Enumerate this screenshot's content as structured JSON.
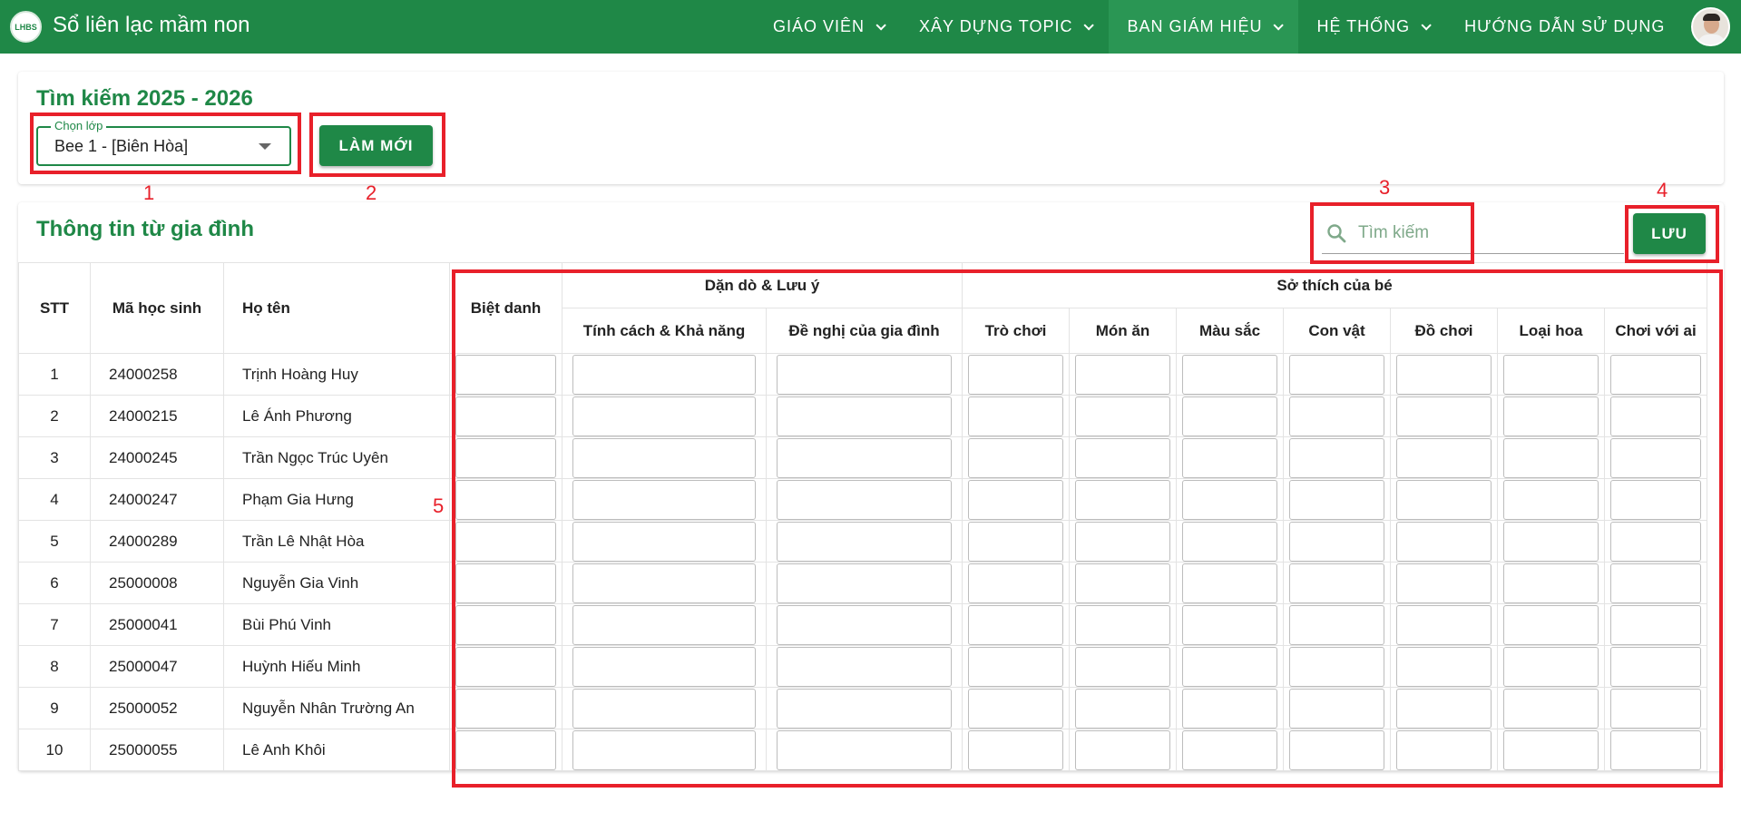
{
  "app": {
    "title": "Sổ liên lạc mầm non",
    "logo_text": "LHBS"
  },
  "nav": [
    {
      "label": "GIÁO VIÊN",
      "has_dropdown": true,
      "active": false
    },
    {
      "label": "XÂY DỰNG TOPIC",
      "has_dropdown": true,
      "active": false
    },
    {
      "label": "BAN GIÁM HIỆU",
      "has_dropdown": true,
      "active": true
    },
    {
      "label": "HỆ THỐNG",
      "has_dropdown": true,
      "active": false
    },
    {
      "label": "HƯỚNG DẪN SỬ DỤNG",
      "has_dropdown": false,
      "active": false
    }
  ],
  "search_card": {
    "title": "Tìm kiếm 2025 - 2026",
    "class_select": {
      "label": "Chọn lớp",
      "value": "Bee 1 - [Biên Hòa]"
    },
    "refresh_label": "LÀM MỚI"
  },
  "family_card": {
    "title": "Thông tin từ gia đình",
    "search_placeholder": "Tìm kiếm",
    "save_label": "LƯU"
  },
  "table": {
    "headers": {
      "stt": "STT",
      "student_code": "Mã học sinh",
      "full_name": "Họ tên",
      "nickname": "Biệt danh",
      "group_notes": "Dặn dò & Lưu ý",
      "personality": "Tính cách & Khả năng",
      "family_suggestion": "Đề nghị của gia đình",
      "group_hobbies": "Sở thích của bé",
      "games": "Trò chơi",
      "food": "Món ăn",
      "colors": "Màu sắc",
      "animals": "Con vật",
      "toys": "Đồ chơi",
      "flowers": "Loại hoa",
      "play_with": "Chơi với ai"
    },
    "rows": [
      {
        "stt": "1",
        "code": "24000258",
        "name": "Trịnh Hoàng Huy"
      },
      {
        "stt": "2",
        "code": "24000215",
        "name": "Lê Ánh Phương"
      },
      {
        "stt": "3",
        "code": "24000245",
        "name": "Trần Ngọc Trúc Uyên"
      },
      {
        "stt": "4",
        "code": "24000247",
        "name": "Phạm Gia Hưng"
      },
      {
        "stt": "5",
        "code": "24000289",
        "name": "Trần Lê Nhật Hòa"
      },
      {
        "stt": "6",
        "code": "25000008",
        "name": "Nguyễn Gia Vinh"
      },
      {
        "stt": "7",
        "code": "25000041",
        "name": "Bùi Phú Vinh"
      },
      {
        "stt": "8",
        "code": "25000047",
        "name": "Huỳnh Hiếu Minh"
      },
      {
        "stt": "9",
        "code": "25000052",
        "name": "Nguyễn Nhân Trường An"
      },
      {
        "stt": "10",
        "code": "25000055",
        "name": "Lê Anh Khôi"
      }
    ]
  },
  "annotations": {
    "n1": "1",
    "n2": "2",
    "n3": "3",
    "n4": "4",
    "n5": "5"
  },
  "colors": {
    "brand_green": "#1f8847",
    "nav_active": "#2a9654",
    "annotation_red": "#e8202a"
  }
}
